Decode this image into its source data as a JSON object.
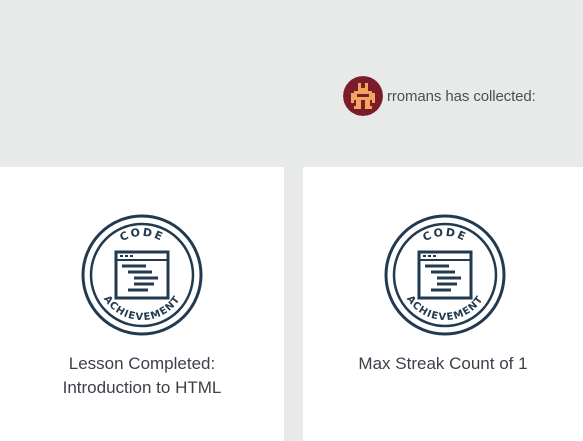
{
  "header": {
    "username": "rromans",
    "collected_text": "rromans has collected:"
  },
  "badges": [
    {
      "icon": "code-achievement-badge-icon",
      "badge_top_text": "CODE",
      "badge_bottom_text": "ACHIEVEMENT",
      "title_line1": "Lesson Completed:",
      "title_line2": "Introduction to HTML"
    },
    {
      "icon": "code-achievement-badge-icon",
      "badge_top_text": "CODE",
      "badge_bottom_text": "ACHIEVEMENT",
      "title_line1": "Max Streak Count of 1",
      "title_line2": ""
    }
  ],
  "colors": {
    "background": "#e8e9e9",
    "card": "#ffffff",
    "badge_stroke": "#223a4f",
    "avatar_bg": "#7a1c2a",
    "avatar_fg": "#f3a55e",
    "text": "#3b4049"
  }
}
